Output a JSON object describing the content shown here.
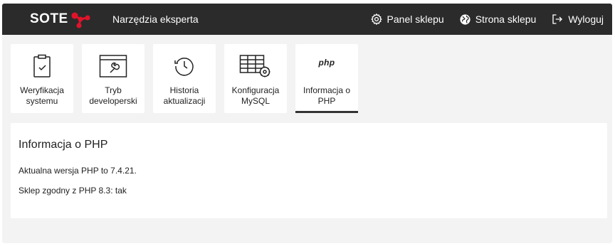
{
  "header": {
    "logo_text": "SOTE",
    "app_title": "Narzędzia eksperta",
    "actions": [
      {
        "label": "Panel sklepu",
        "icon": "gear-icon"
      },
      {
        "label": "Strona sklepu",
        "icon": "globe-icon"
      },
      {
        "label": "Wyloguj",
        "icon": "logout-icon"
      }
    ]
  },
  "tiles": [
    {
      "label": "Weryfikacja\nsystemu",
      "icon": "clipboard-check-icon"
    },
    {
      "label": "Tryb\ndeveloperski",
      "icon": "developer-window-wrench-icon"
    },
    {
      "label": "Historia\naktualizacji",
      "icon": "history-clock-icon"
    },
    {
      "label": "Konfiguracja\nMySQL",
      "icon": "table-gear-icon"
    },
    {
      "label": "Informacja o\nPHP",
      "icon": "php-logo-icon",
      "icon_text": "php",
      "active": true
    }
  ],
  "panel": {
    "title": "Informacja o PHP",
    "lines": [
      "Aktualna wersja PHP to 7.4.21.",
      "Sklep zgodny z PHP 8.3: tak"
    ]
  },
  "colors": {
    "topbar": "#2b2b2b",
    "page_background": "#f3f3f3",
    "brand_accent": "#e1132a"
  }
}
